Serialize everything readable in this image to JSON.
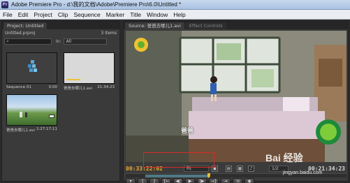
{
  "window": {
    "title": "Adobe Premiere Pro - d:\\我的文档\\Adobe\\Premiere Pro\\6.0\\Untitled *"
  },
  "menu": [
    "File",
    "Edit",
    "Project",
    "Clip",
    "Sequence",
    "Marker",
    "Title",
    "Window",
    "Help"
  ],
  "project_panel": {
    "tab_label": "Project: Untitled",
    "file_name": "Untitled.prproj",
    "item_count": "3 Items",
    "in_label": "In:",
    "in_value": "All",
    "items": [
      {
        "name": "Sequence 01",
        "duration": "0:00"
      },
      {
        "name": "爸爸去哪儿1.avi",
        "duration": "21:34:23"
      },
      {
        "name": "爸爸去哪儿1.avi",
        "duration": "1:27:17:11"
      }
    ]
  },
  "source_panel": {
    "tab_label": "Source: 爸爸去哪儿1.avi",
    "tab2_label": "Effect Controls",
    "current_time": "00:33:22:02",
    "duration": "00:21:34:23",
    "fit_value": "Fit",
    "ratio_value": "1/2",
    "subtitle": "爸爸",
    "progress": 0.37,
    "watermark": "Bai 经验",
    "watermark_url": "jingyan.baidu.com"
  },
  "colors": {
    "timecode_accent": "#e7a929",
    "selection_box": "#d62828",
    "scrub_fill": "#4f7a84"
  }
}
